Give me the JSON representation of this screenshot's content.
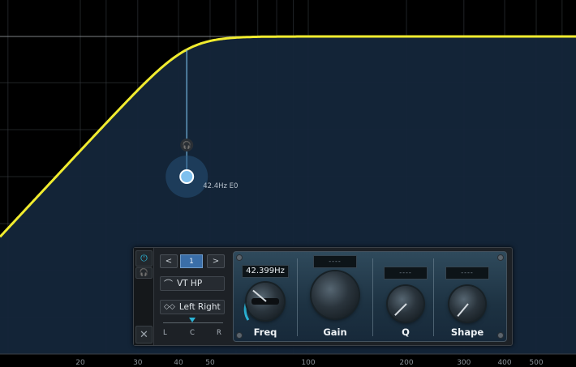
{
  "graph": {
    "freq_ticks": [
      {
        "label": "20",
        "value": 20
      },
      {
        "label": "30",
        "value": 30
      },
      {
        "label": "40",
        "value": 40
      },
      {
        "label": "50",
        "value": 50
      },
      {
        "label": "100",
        "value": 100
      },
      {
        "label": "200",
        "value": 200
      },
      {
        "label": "300",
        "value": 300
      },
      {
        "label": "400",
        "value": 400
      },
      {
        "label": "500",
        "value": 500
      }
    ],
    "curve_color": "#f1ec2f",
    "node": {
      "label": "42.4Hz E0",
      "freq_hz": 42.4
    }
  },
  "panel": {
    "preset_number": "1",
    "prev_label": "<",
    "next_label": ">",
    "filter_type": "VT HP",
    "channel": "Left Right",
    "lcr": {
      "l": "L",
      "c": "C",
      "r": "R"
    },
    "freq": {
      "readout": "42.399Hz",
      "label": "Freq"
    },
    "gain": {
      "readout": "----",
      "label": "Gain"
    },
    "q": {
      "readout": "----",
      "label": "Q"
    },
    "shape": {
      "readout": "----",
      "label": "Shape"
    },
    "accent_color": "#2bb3d6"
  }
}
